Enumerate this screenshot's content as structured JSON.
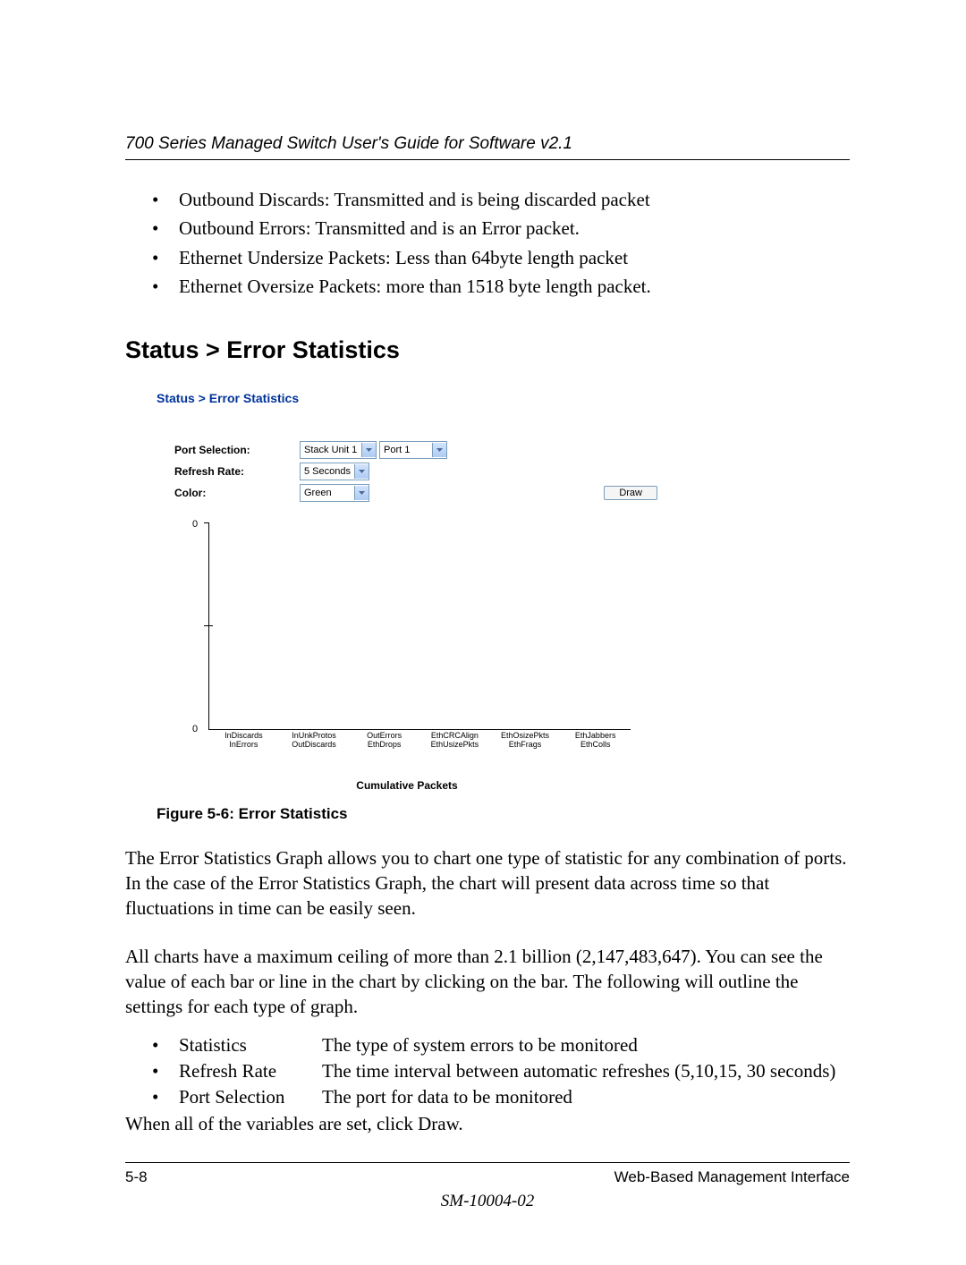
{
  "header": {
    "running_title": "700 Series Managed Switch User's Guide for Software v2.1"
  },
  "bullets_top": [
    "Outbound Discards: Transmitted and is being discarded packet",
    "Outbound Errors: Transmitted and is an Error packet.",
    "Ethernet Undersize Packets: Less than 64byte length packet",
    "Ethernet Oversize Packets: more than 1518 byte length packet."
  ],
  "section_heading": "Status > Error Statistics",
  "figure": {
    "breadcrumb": "Status > Error Statistics",
    "form": {
      "port_label": "Port Selection:",
      "refresh_label": "Refresh Rate:",
      "color_label": "Color:",
      "stack_value": "Stack Unit 1",
      "port_value": "Port 1",
      "refresh_value": "5 Seconds",
      "color_value": "Green",
      "draw_label": "Draw"
    },
    "chart": {
      "ytick_top": "0",
      "ytick_bottom": "0",
      "x_top": [
        "InDiscards",
        "InUnkProtos",
        "OutErrors",
        "EthCRCAlign",
        "EthOsizePkts",
        "EthJabbers"
      ],
      "x_bot": [
        "InErrors",
        "OutDiscards",
        "EthDrops",
        "EthUsizePkts",
        "EthFrags",
        "EthColls"
      ],
      "caption": "Cumulative Packets"
    },
    "caption": "Figure 5-6:  Error Statistics"
  },
  "chart_data": {
    "type": "bar",
    "title": "Cumulative Packets",
    "categories": [
      "InDiscards",
      "InErrors",
      "InUnkProtos",
      "OutDiscards",
      "OutErrors",
      "EthDrops",
      "EthCRCAlign",
      "EthUsizePkts",
      "EthOsizePkts",
      "EthFrags",
      "EthJabbers",
      "EthColls"
    ],
    "values": [
      0,
      0,
      0,
      0,
      0,
      0,
      0,
      0,
      0,
      0,
      0,
      0
    ],
    "ylim": [
      0,
      0
    ],
    "xlabel": "",
    "ylabel": ""
  },
  "para1": "The Error Statistics Graph allows you to chart one type of statistic for any combination of ports. In the case of the Error Statistics Graph, the chart will present data across time so that fluctuations in time can be easily seen.",
  "para2": "All charts have a maximum ceiling of more than 2.1 billion (2,147,483,647). You can see the value of each bar or line in the chart by clicking on the bar. The following will outline the settings for each type of graph.",
  "defs": [
    {
      "term": "Statistics",
      "desc": "The type of system errors to be monitored"
    },
    {
      "term": "Refresh Rate",
      "desc": "The time interval between automatic refreshes (5,10,15, 30 seconds)"
    },
    {
      "term": "Port Selection",
      "desc": "The port for data to be monitored"
    }
  ],
  "closing": "When all of the variables are set, click Draw.",
  "footer": {
    "page": "5-8",
    "section": "Web-Based Management Interface",
    "docid": "SM-10004-02"
  }
}
